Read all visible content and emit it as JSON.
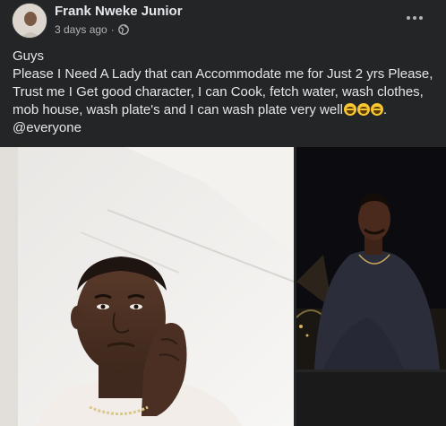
{
  "post": {
    "author": "Frank Nweke Junior",
    "timestamp": "3 days ago",
    "separator": "·",
    "privacy_icon": "globe-icon",
    "menu_icon": "more-horizontal-icon",
    "text_lines": [
      "Guys",
      "Please I Need A Lady that can Accommodate me for Just 2 yrs Please,",
      "Trust me I Get good character, I can Cook, fetch water, wash clothes,",
      "mob house, wash plate's and I can wash plate very well"
    ],
    "emoji_count": 3,
    "emoji_name": "grimacing-laugh-emoji",
    "mention": "@everyone"
  },
  "photos": [
    {
      "name": "selfie-photo"
    },
    {
      "name": "night-photo"
    },
    {
      "name": "third-photo"
    }
  ],
  "colors": {
    "background": "#242526",
    "primary_text": "#e4e6eb",
    "secondary_text": "#b0b3b8"
  }
}
